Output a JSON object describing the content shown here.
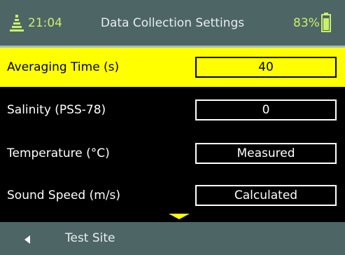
{
  "header": {
    "time": "21:04",
    "title": "Data Collection Settings",
    "battery_percent": "83%",
    "signal_icon": "antenna-icon",
    "battery_icon": "battery-icon",
    "battery_level": 0.83
  },
  "settings": [
    {
      "label": "Averaging Time (s)",
      "value": "40",
      "selected": true
    },
    {
      "label": "Salinity (PSS-78)",
      "value": "0",
      "selected": false
    },
    {
      "label": "Temperature (°C)",
      "value": "Measured",
      "selected": false
    },
    {
      "label": "Sound Speed (m/s)",
      "value": "Calculated",
      "selected": false
    }
  ],
  "more_indicator_icon": "chevron-down-icon",
  "footer": {
    "back_icon": "left-triangle-icon",
    "label": "Test Site"
  },
  "colors": {
    "header_bg": "#4e6566",
    "accent_green": "#c9f06a",
    "selection_yellow": "#ffff00",
    "background": "#000000"
  }
}
